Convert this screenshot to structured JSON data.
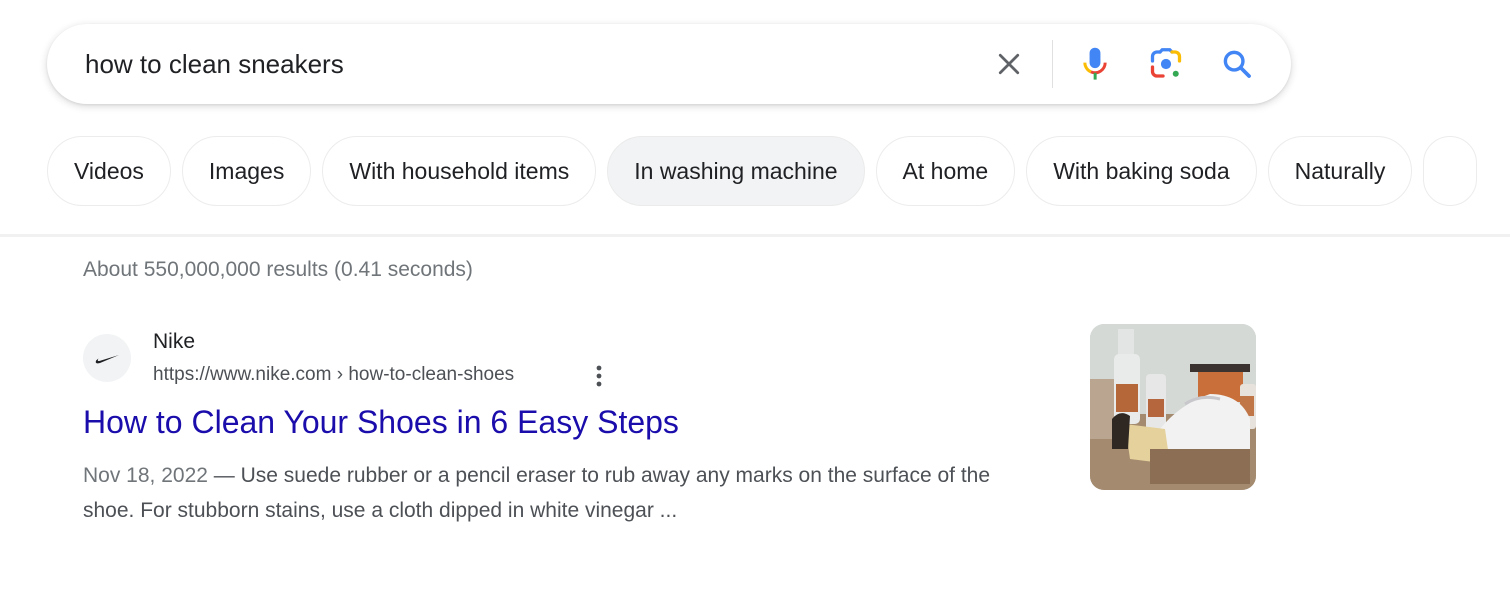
{
  "search": {
    "query": "how to clean sneakers",
    "icons": {
      "clear": "close-icon",
      "voice": "microphone-icon",
      "lens": "google-lens-icon",
      "search": "search-icon"
    }
  },
  "chips": [
    {
      "label": "Videos",
      "active": false
    },
    {
      "label": "Images",
      "active": false
    },
    {
      "label": "With household items",
      "active": false
    },
    {
      "label": "In washing machine",
      "active": true
    },
    {
      "label": "At home",
      "active": false
    },
    {
      "label": "With baking soda",
      "active": false
    },
    {
      "label": "Naturally",
      "active": false
    }
  ],
  "result_stats": "About 550,000,000 results (0.41 seconds)",
  "results": [
    {
      "site_name": "Nike",
      "favicon": "nike-swoosh-icon",
      "url": "https://www.nike.com › how-to-clean-shoes",
      "title": "How to Clean Your Shoes in 6 Easy Steps",
      "date": "Nov 18, 2022",
      "separator": " — ",
      "snippet": "Use suede rubber or a pencil eraser to rub away any marks on the surface of the shoe. For stubborn stains, use a cloth dipped in white vinegar ...",
      "thumbnail_alt": "Shoe cleaning supplies with white sneakers on a wooden box"
    }
  ],
  "colors": {
    "link": "#1a0dab",
    "text": "#202124",
    "muted": "#70757a",
    "snippet": "#4d5156",
    "google_blue": "#4285f4",
    "google_red": "#ea4335",
    "google_yellow": "#fbbc04",
    "google_green": "#34a853"
  }
}
